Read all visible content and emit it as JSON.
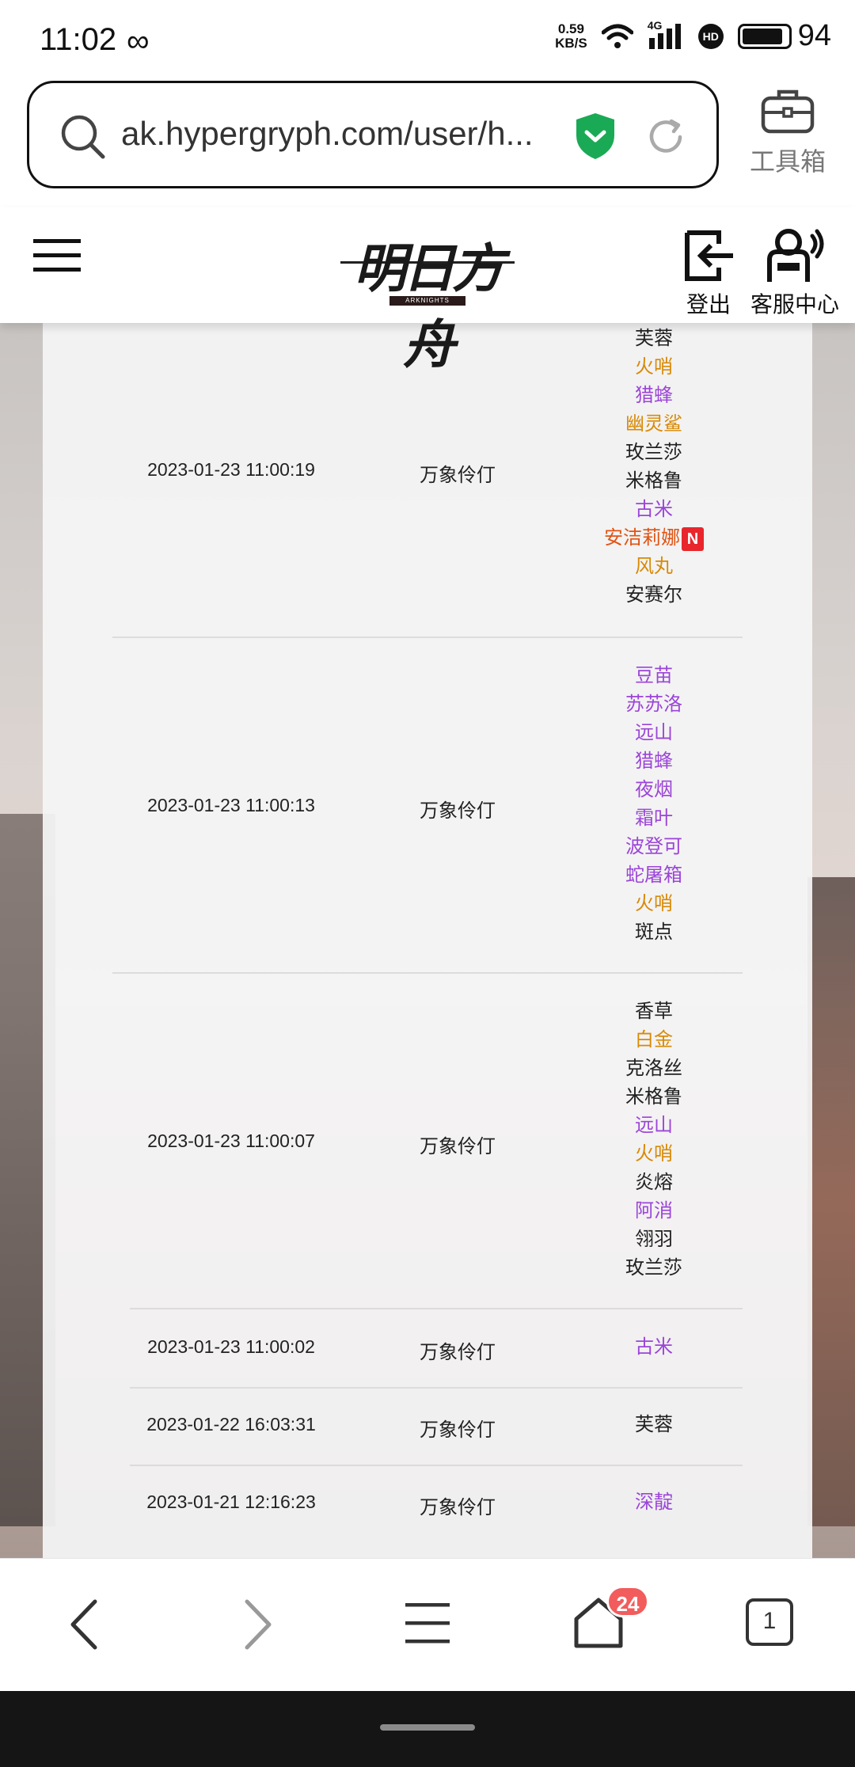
{
  "status_bar": {
    "time": "11:02",
    "loop_icon": "infinity-icon",
    "net_speed_value": "0.59",
    "net_speed_unit": "KB/S",
    "network": "4G",
    "hd": "HD",
    "battery": "94"
  },
  "browser": {
    "url": "ak.hypergryph.com/user/h...",
    "toolbox_label": "工具箱"
  },
  "site_header": {
    "logo_text": "明日方舟",
    "logo_sub": "ARKNIGHTS",
    "logout_label": "登出",
    "customer_service_label": "客服中心"
  },
  "records": [
    {
      "time": "2023-01-23 11:00:19",
      "pool": "万象伶仃",
      "operators": [
        {
          "name": "芙蓉",
          "rarity": 3
        },
        {
          "name": "火哨",
          "rarity": 5
        },
        {
          "name": "猎蜂",
          "rarity": 4
        },
        {
          "name": "幽灵鲨",
          "rarity": 5
        },
        {
          "name": "玫兰莎",
          "rarity": 3
        },
        {
          "name": "米格鲁",
          "rarity": 3
        },
        {
          "name": "古米",
          "rarity": 4
        },
        {
          "name": "安洁莉娜",
          "rarity": 6,
          "new": "N"
        },
        {
          "name": "风丸",
          "rarity": 5
        },
        {
          "name": "安赛尔",
          "rarity": 3
        }
      ]
    },
    {
      "time": "2023-01-23 11:00:13",
      "pool": "万象伶仃",
      "operators": [
        {
          "name": "豆苗",
          "rarity": 4
        },
        {
          "name": "苏苏洛",
          "rarity": 4
        },
        {
          "name": "远山",
          "rarity": 4
        },
        {
          "name": "猎蜂",
          "rarity": 4
        },
        {
          "name": "夜烟",
          "rarity": 4
        },
        {
          "name": "霜叶",
          "rarity": 4
        },
        {
          "name": "波登可",
          "rarity": 4
        },
        {
          "name": "蛇屠箱",
          "rarity": 4
        },
        {
          "name": "火哨",
          "rarity": 5
        },
        {
          "name": "斑点",
          "rarity": 3
        }
      ]
    },
    {
      "time": "2023-01-23 11:00:07",
      "pool": "万象伶仃",
      "operators": [
        {
          "name": "香草",
          "rarity": 3
        },
        {
          "name": "白金",
          "rarity": 5
        },
        {
          "name": "克洛丝",
          "rarity": 3
        },
        {
          "name": "米格鲁",
          "rarity": 3
        },
        {
          "name": "远山",
          "rarity": 4
        },
        {
          "name": "火哨",
          "rarity": 5
        },
        {
          "name": "炎熔",
          "rarity": 3
        },
        {
          "name": "阿消",
          "rarity": 4
        },
        {
          "name": "翎羽",
          "rarity": 3
        },
        {
          "name": "玫兰莎",
          "rarity": 3
        }
      ]
    },
    {
      "time": "2023-01-23 11:00:02",
      "pool": "万象伶仃",
      "operators": [
        {
          "name": "古米",
          "rarity": 4
        }
      ]
    },
    {
      "time": "2023-01-22 16:03:31",
      "pool": "万象伶仃",
      "operators": [
        {
          "name": "芙蓉",
          "rarity": 3
        }
      ]
    },
    {
      "time": "2023-01-21 12:16:23",
      "pool": "万象伶仃",
      "operators": [
        {
          "name": "深靛",
          "rarity": 4
        }
      ]
    }
  ],
  "bottom_nav": {
    "tabs_badge": "24",
    "tab_count": "1"
  },
  "colors": {
    "rarity_3": "#222222",
    "rarity_4": "#9b45d8",
    "rarity_5": "#d88a06",
    "rarity_6": "#e05414",
    "shield_green": "#1aaa55",
    "badge_red": "#f25c5c"
  }
}
